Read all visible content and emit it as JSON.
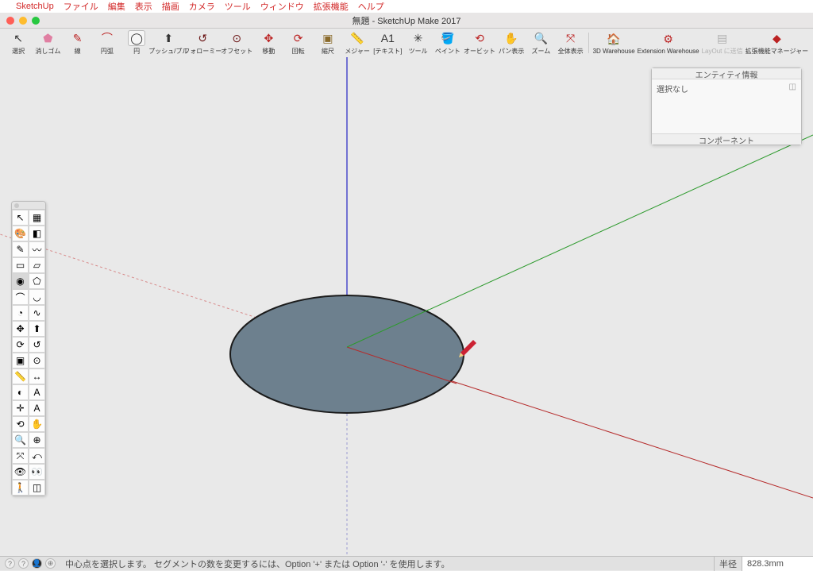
{
  "menubar": {
    "app": "SketchUp",
    "items": [
      "ファイル",
      "編集",
      "表示",
      "描画",
      "カメラ",
      "ツール",
      "ウィンドウ",
      "拡張機能",
      "ヘルプ"
    ]
  },
  "window": {
    "title": "無題 - SketchUp Make 2017"
  },
  "toolbar": [
    {
      "name": "select-tool",
      "label": "選択",
      "icon": "↖",
      "interactable": true
    },
    {
      "name": "eraser-tool",
      "label": "消しゴム",
      "icon": "⬟",
      "color": "#e07fa2",
      "interactable": true
    },
    {
      "name": "line-tool",
      "label": "線",
      "icon": "✎",
      "color": "#b22",
      "interactable": true
    },
    {
      "name": "arc-tool",
      "label": "円弧",
      "icon": "⌒",
      "color": "#b22",
      "interactable": true
    },
    {
      "name": "circle-tool",
      "label": "円",
      "icon": "◯",
      "boxed": true,
      "interactable": true
    },
    {
      "name": "pushpull-tool",
      "label": "プッシュ/プル",
      "icon": "⬆",
      "interactable": true
    },
    {
      "name": "followme-tool",
      "label": "フォローミー",
      "icon": "↺",
      "color": "#6a1414",
      "interactable": true
    },
    {
      "name": "offset-tool",
      "label": "オフセット",
      "icon": "⊙",
      "color": "#6a1414",
      "interactable": true
    },
    {
      "name": "move-tool",
      "label": "移動",
      "icon": "✥",
      "color": "#b22",
      "interactable": true
    },
    {
      "name": "rotate-tool",
      "label": "回転",
      "icon": "⟳",
      "color": "#b22",
      "interactable": true
    },
    {
      "name": "scale-tool",
      "label": "縮尺",
      "icon": "▣",
      "color": "#8a6a2a",
      "interactable": true
    },
    {
      "name": "tape-tool",
      "label": "メジャー",
      "icon": "📏",
      "interactable": true
    },
    {
      "name": "text-tool",
      "label": "[テキスト]",
      "icon": "A1",
      "interactable": true
    },
    {
      "name": "toolbox-tool",
      "label": "ツール",
      "icon": "✳",
      "interactable": true
    },
    {
      "name": "paint-tool",
      "label": "ペイント",
      "icon": "🪣",
      "interactable": true
    },
    {
      "name": "orbit-tool",
      "label": "オービット",
      "icon": "⟲",
      "color": "#b22",
      "interactable": true
    },
    {
      "name": "pan-tool",
      "label": "パン表示",
      "icon": "✋",
      "color": "#b22",
      "interactable": true
    },
    {
      "name": "zoom-tool",
      "label": "ズーム",
      "icon": "🔍",
      "interactable": true
    },
    {
      "name": "zoom-extents-tool",
      "label": "全体表示",
      "icon": "⤧",
      "color": "#b22",
      "interactable": true
    },
    {
      "name": "3d-warehouse",
      "label": "3D Warehouse",
      "icon": "🏠",
      "wide": true,
      "interactable": true
    },
    {
      "name": "extension-warehouse",
      "label": "Extension Warehouse",
      "icon": "⚙",
      "xwide": true,
      "color": "#b22",
      "interactable": true
    },
    {
      "name": "send-to-layout",
      "label": "LayOut に送信",
      "icon": "▤",
      "wide": true,
      "dim": true,
      "interactable": false
    },
    {
      "name": "extension-manager",
      "label": "拡張機能マネージャー",
      "icon": "◆",
      "xwide": true,
      "color": "#b22",
      "interactable": true
    }
  ],
  "palette": {
    "rows": [
      [
        "select-tool",
        "↖",
        "component-tool",
        "▦"
      ],
      [
        "paint-tool",
        "🎨",
        "eraser-tool",
        "◧"
      ],
      [
        "line-tool",
        "✎",
        "freehand-tool",
        "〰"
      ],
      [
        "rectangle-tool",
        "▭",
        "rotated-rect-tool",
        "▱"
      ],
      [
        "circle-tool",
        "◉",
        "polygon-tool",
        "⬠"
      ],
      [
        "arc-tool",
        "⌒",
        "two-point-arc-tool",
        "◡"
      ],
      [
        "pie-tool",
        "◔",
        "curve-tool",
        "∿"
      ],
      [
        "move-tool",
        "✥",
        "pushpull-tool",
        "⬆"
      ],
      [
        "rotate-tool",
        "⟳",
        "followme-tool",
        "↺"
      ],
      [
        "scale-tool",
        "▣",
        "offset-tool",
        "⊙"
      ],
      [
        "tape-tool",
        "📏",
        "dimension-tool",
        "↔"
      ],
      [
        "protractor-tool",
        "◐",
        "text-tool",
        "A"
      ],
      [
        "axes-tool",
        "✛",
        "3dtext-tool",
        "A"
      ],
      [
        "orbit-tool",
        "⟲",
        "pan-tool",
        "✋"
      ],
      [
        "zoom-tool",
        "🔍",
        "zoom-window-tool",
        "⊕"
      ],
      [
        "zoom-extents-tool",
        "⤧",
        "previous-view-tool",
        "⤺"
      ],
      [
        "position-camera-tool",
        "👁",
        "look-around-tool",
        "👀"
      ],
      [
        "walk-tool",
        "🚶",
        "section-plane-tool",
        "◫"
      ]
    ],
    "selected": "circle-tool"
  },
  "entity_panel": {
    "title": "エンティティ情報",
    "body": "選択なし",
    "footer": "コンポーネント"
  },
  "status": {
    "message": "中心点を選択します。 セグメントの数を変更するには、Option '+' または Option '-' を使用します。",
    "measure_label": "半径",
    "measure_value": "828.3mm"
  }
}
